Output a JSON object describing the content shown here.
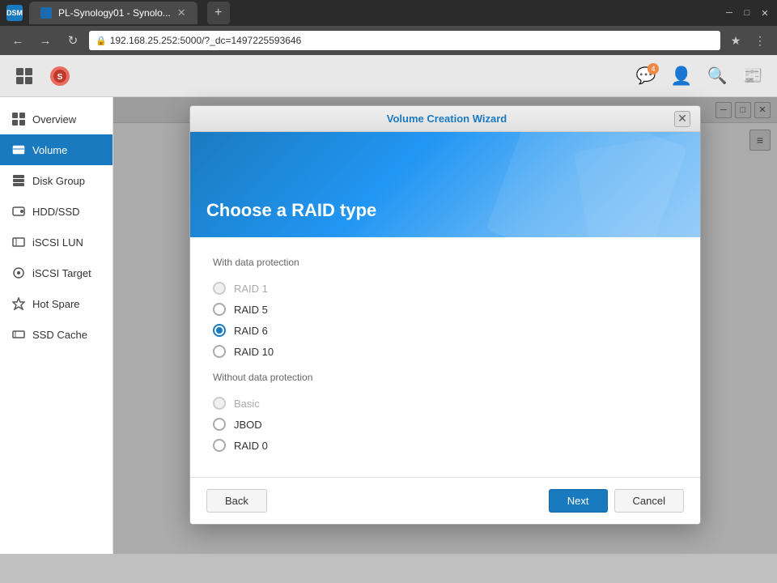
{
  "browser": {
    "tab_label": "PL-Synology01 - Synolo...",
    "url": "192.168.25.252:5000/?_dc=1497225593646",
    "new_tab_label": "+"
  },
  "toolbar": {
    "notification_count": "4"
  },
  "sidebar": {
    "items": [
      {
        "id": "overview",
        "label": "Overview"
      },
      {
        "id": "volume",
        "label": "Volume",
        "active": true
      },
      {
        "id": "disk-group",
        "label": "Disk Group"
      },
      {
        "id": "hdd-ssd",
        "label": "HDD/SSD"
      },
      {
        "id": "iscsi-lun",
        "label": "iSCSI LUN"
      },
      {
        "id": "iscsi-target",
        "label": "iSCSI Target"
      },
      {
        "id": "hot-spare",
        "label": "Hot Spare"
      },
      {
        "id": "ssd-cache",
        "label": "SSD Cache"
      }
    ]
  },
  "dialog": {
    "title": "Volume Creation Wizard",
    "banner_title": "Choose a RAID type",
    "close_label": "✕",
    "with_protection_label": "With data protection",
    "without_protection_label": "Without data protection",
    "raid_options": [
      {
        "id": "raid1",
        "label": "RAID 1",
        "checked": false,
        "disabled": true
      },
      {
        "id": "raid5",
        "label": "RAID 5",
        "checked": false,
        "disabled": false
      },
      {
        "id": "raid6",
        "label": "RAID 6",
        "checked": true,
        "disabled": false
      },
      {
        "id": "raid10",
        "label": "RAID 10",
        "checked": false,
        "disabled": false
      }
    ],
    "no_protection_options": [
      {
        "id": "basic",
        "label": "Basic",
        "checked": false,
        "disabled": true
      },
      {
        "id": "jbod",
        "label": "JBOD",
        "checked": false,
        "disabled": false
      },
      {
        "id": "raid0",
        "label": "RAID 0",
        "checked": false,
        "disabled": false
      }
    ],
    "back_label": "Back",
    "next_label": "Next",
    "cancel_label": "Cancel"
  }
}
